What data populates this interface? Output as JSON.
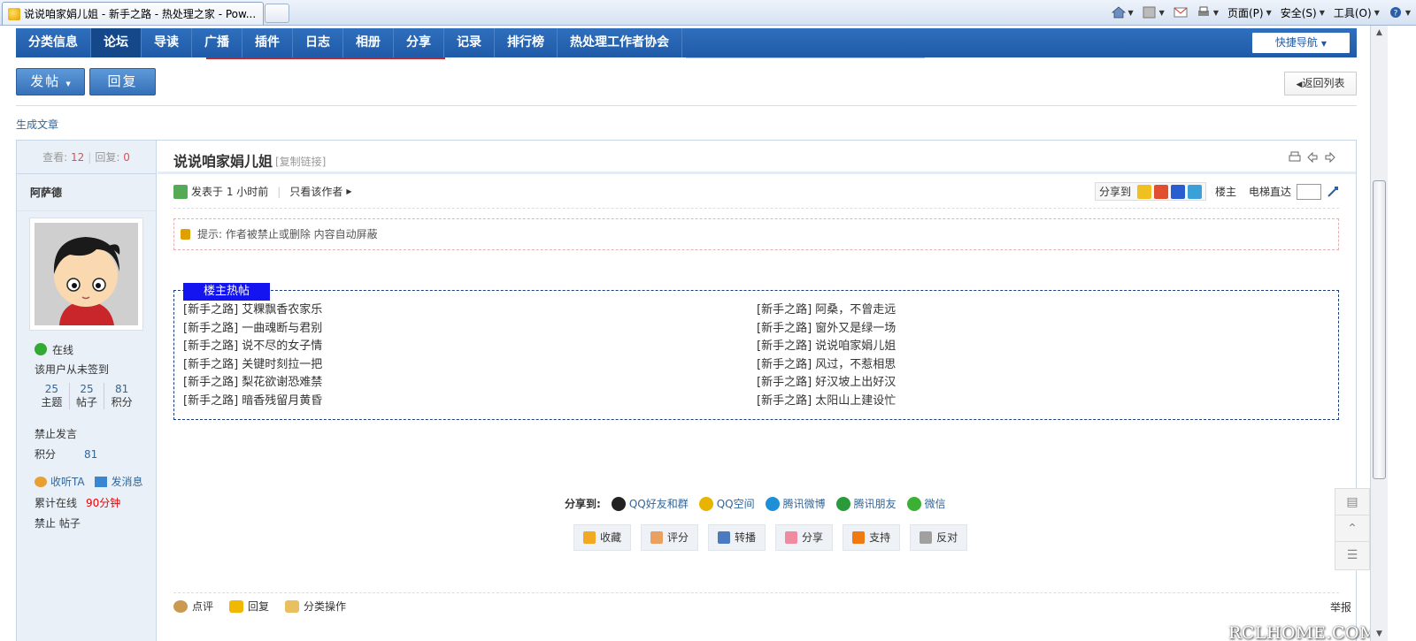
{
  "browser": {
    "tab_title": "说说咱家娟儿姐 - 新手之路 - 热处理之家 - Pow...",
    "commands": [
      {
        "icon": "home-icon",
        "label": ""
      },
      {
        "icon": "rss-icon",
        "label": ""
      },
      {
        "icon": "mail-icon",
        "label": ""
      },
      {
        "icon": "print-icon",
        "label": ""
      },
      {
        "icon": "page-icon",
        "label": "页面(P)"
      },
      {
        "icon": "safety-icon",
        "label": "安全(S)"
      },
      {
        "icon": "tools-icon",
        "label": "工具(O)"
      },
      {
        "icon": "help-icon",
        "label": ""
      }
    ]
  },
  "nav": {
    "items": [
      "分类信息",
      "论坛",
      "导读",
      "广播",
      "插件",
      "日志",
      "相册",
      "分享",
      "记录",
      "排行榜",
      "热处理工作者协会"
    ],
    "active_index": 1,
    "quick_nav": "快捷导航"
  },
  "actions": {
    "post": "发帖",
    "reply": "回复",
    "back_to_list": "返回列表"
  },
  "generate_article": "生成文章",
  "sidebar": {
    "views_label": "查看:",
    "views": "12",
    "replies_label": "回复:",
    "replies": "0",
    "author": "阿萨德",
    "online": "在线",
    "sign_status": "该用户从未签到",
    "counts": [
      {
        "value": "25",
        "label": "主题"
      },
      {
        "value": "25",
        "label": "帖子"
      },
      {
        "value": "81",
        "label": "积分"
      }
    ],
    "banned": "禁止发言",
    "points_label": "积分",
    "points": "81",
    "follow": "收听TA",
    "message": "发消息",
    "online_total_label": "累计在线",
    "online_total": "90分钟",
    "ban_posts": "禁止 帖子"
  },
  "post": {
    "title": "说说咱家娟儿姐",
    "copy_link": "[复制链接]",
    "posted": "发表于 1 小时前",
    "only_author": "只看该作者",
    "share_to": "分享到",
    "floor": "楼主",
    "elevator": "电梯直达",
    "notice": "提示: 作者被禁止或删除 内容自动屏蔽"
  },
  "hot_posts": {
    "tag": "楼主热帖",
    "left": [
      "[新手之路] 艾粿飘香农家乐",
      "[新手之路] 一曲魂断与君别",
      "[新手之路] 说不尽的女子情",
      "[新手之路] 关键时刻拉一把",
      "[新手之路] 梨花欲谢恐难禁",
      "[新手之路] 暗香残留月黄昏"
    ],
    "right": [
      "[新手之路] 阿桑，不曾走远",
      "[新手之路] 窗外又是绿一场",
      "[新手之路] 说说咱家娟儿姐",
      "[新手之路] 风过，不惹相思",
      "[新手之路] 好汉坡上出好汉",
      "[新手之路] 太阳山上建设忙"
    ]
  },
  "share_row": {
    "label": "分享到:",
    "items": [
      {
        "label": "QQ好友和群",
        "color": "#222222"
      },
      {
        "label": "QQ空间",
        "color": "#e8b400"
      },
      {
        "label": "腾讯微博",
        "color": "#1e90d8"
      },
      {
        "label": "腾讯朋友",
        "color": "#2a9a3a"
      },
      {
        "label": "微信",
        "color": "#3cb034"
      }
    ]
  },
  "post_actions": [
    {
      "label": "收藏",
      "color": "#f2a820"
    },
    {
      "label": "评分",
      "color": "#e9a060"
    },
    {
      "label": "转播",
      "color": "#4a7ac0"
    },
    {
      "label": "分享",
      "color": "#f08aa0"
    },
    {
      "label": "支持",
      "color": "#f07a10"
    },
    {
      "label": "反对",
      "color": "#a0a0a0"
    }
  ],
  "footer": {
    "comment": "点评",
    "reply": "回复",
    "category_ops": "分类操作",
    "report": "举报"
  },
  "watermark": "RCLHOME.COM"
}
